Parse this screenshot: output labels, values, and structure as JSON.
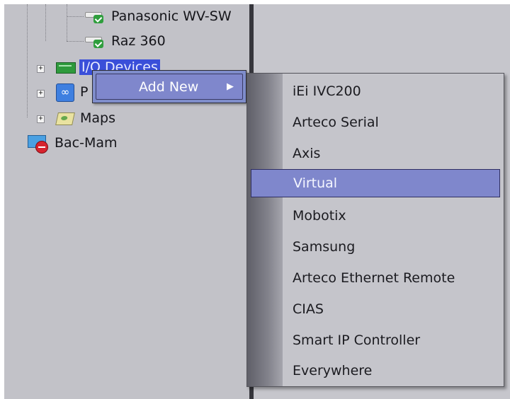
{
  "tree": {
    "cameras": [
      {
        "label": "Panasonic WV-SW",
        "icon": "camera-ok-icon"
      },
      {
        "label": "Raz 360",
        "icon": "camera-ok-icon"
      }
    ],
    "nodes": [
      {
        "label": "I/O Devices",
        "icon": "io-board-icon",
        "expander": "+",
        "selected": true
      },
      {
        "label": "P",
        "icon": "link-icon",
        "expander": "+"
      },
      {
        "label": "Maps",
        "icon": "map-icon",
        "expander": "+"
      },
      {
        "label": "Bac-Mam",
        "icon": "server-offline-icon"
      }
    ]
  },
  "context_menu": {
    "items": [
      {
        "label": "Add New",
        "submenu_arrow": "▶"
      }
    ]
  },
  "submenu": {
    "items": [
      {
        "label": "iEi IVC200"
      },
      {
        "label": "Arteco Serial"
      },
      {
        "label": "Axis"
      },
      {
        "label": "Virtual",
        "highlighted": true
      },
      {
        "label": "Mobotix"
      },
      {
        "label": "Samsung"
      },
      {
        "label": "Arteco Ethernet Remote"
      },
      {
        "label": "CIAS"
      },
      {
        "label": "Smart IP Controller"
      },
      {
        "label": "Everywhere"
      }
    ]
  },
  "colors": {
    "selection": "#3a4fd9",
    "menu_highlight": "#7f87cc",
    "panel": "#c2c2c8",
    "splitter": "#36363c"
  }
}
